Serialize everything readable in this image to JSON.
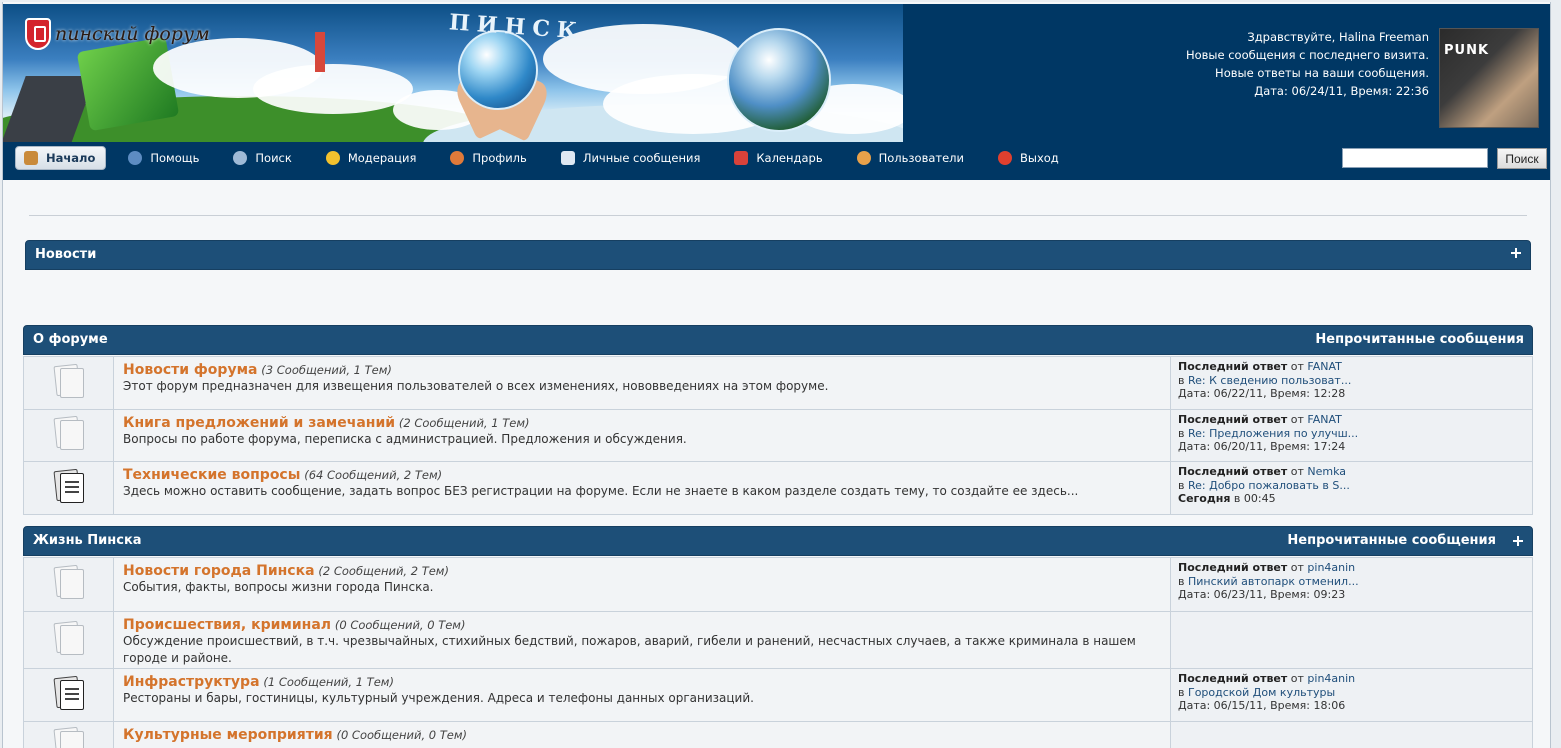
{
  "header": {
    "logo_text": "пинский форум",
    "banner_word": "ПИНСК",
    "user": {
      "greeting": "Здравствуйте, Halina Freeman",
      "new_since_visit": "Новые сообщения с последнего визита.",
      "new_replies": "Новые ответы на ваши сообщения.",
      "datetime": "Дата: 06/24/11, Время: 22:36"
    },
    "avatar_text": "PUNK"
  },
  "nav": {
    "items": [
      {
        "label": "Начало",
        "icon": "home-icon",
        "color": "#c98a3a"
      },
      {
        "label": "Помощь",
        "icon": "help-icon",
        "color": "#5d8cc2"
      },
      {
        "label": "Поиск",
        "icon": "search-icon",
        "color": "#9fbad6"
      },
      {
        "label": "Модерация",
        "icon": "star-icon",
        "color": "#f2c12e"
      },
      {
        "label": "Профиль",
        "icon": "profile-icon",
        "color": "#e07a3a"
      },
      {
        "label": "Личные сообщения",
        "icon": "mail-icon",
        "color": "#dfe8f2"
      },
      {
        "label": "Календарь",
        "icon": "calendar-icon",
        "color": "#d9423a"
      },
      {
        "label": "Пользователи",
        "icon": "users-icon",
        "color": "#e8a14a"
      },
      {
        "label": "Выход",
        "icon": "logout-icon",
        "color": "#e0402f"
      }
    ],
    "search_button": "Поиск",
    "search_value": ""
  },
  "news": {
    "title": "Новости"
  },
  "categories": [
    {
      "title": "О форуме",
      "unread": "Непрочитанные сообщения",
      "boards": [
        {
          "name": "Новости форума",
          "stats": "(3 Сообщений, 1 Тем)",
          "desc": "Этот форум предназначен для извещения пользователей о всех изменениях, нововведениях на этом форуме.",
          "icon": "board-read-icon",
          "last": {
            "label": "Последний ответ",
            "from": "от",
            "author": "FANAT",
            "in": "в",
            "topic": "Re: К сведению пользоват...",
            "date": "Дата: 06/22/11, Время: 12:28"
          }
        },
        {
          "name": "Книга предложений и замечаний",
          "stats": "(2 Сообщений, 1 Тем)",
          "desc": "Вопросы по работе форума, переписка с администрацией. Предложения и обсуждения.",
          "icon": "board-read-icon",
          "last": {
            "label": "Последний ответ",
            "from": "от",
            "author": "FANAT",
            "in": "в",
            "topic": "Re: Предложения по улучш...",
            "date": "Дата: 06/20/11, Время: 17:24"
          }
        },
        {
          "name": "Технические вопросы",
          "stats": "(64 Сообщений, 2 Тем)",
          "desc": "Здесь можно оставить сообщение, задать вопрос БЕЗ регистрации на форуме. Если не знаете в каком разделе создать тему, то создайте ее здесь...",
          "icon": "board-new-icon",
          "last": {
            "label": "Последний ответ",
            "from": "от",
            "author": "Nemka",
            "in": "в",
            "topic": "Re: Добро пожаловать в S...",
            "date_bold": "Сегодня",
            "date": "в 00:45"
          }
        }
      ]
    },
    {
      "title": "Жизнь Пинска",
      "unread": "Непрочитанные сообщения",
      "boards": [
        {
          "name": "Новости города Пинска",
          "stats": "(2 Сообщений, 2 Тем)",
          "desc": "События, факты, вопросы жизни города Пинска.",
          "icon": "board-read-icon",
          "last": {
            "label": "Последний ответ",
            "from": "от",
            "author": "pin4anin",
            "in": "в",
            "topic": "Пинский автопарк отменил...",
            "date": "Дата: 06/23/11, Время: 09:23"
          }
        },
        {
          "name": "Происшествия, криминал",
          "stats": "(0 Сообщений, 0 Тем)",
          "desc": "Обсуждение происшествий, в т.ч. чрезвычайных, стихийных бедствий, пожаров, аварий, гибели и ранений, несчастных случаев, а также криминала в нашем городе и районе.",
          "icon": "board-read-icon",
          "last": null
        },
        {
          "name": "Инфраструктура",
          "stats": "(1 Сообщений, 1 Тем)",
          "desc": "Рестораны и бары, гостиницы, культурный учреждения. Адреса и телефоны данных организаций.",
          "icon": "board-new-icon",
          "last": {
            "label": "Последний ответ",
            "from": "от",
            "author": "pin4anin",
            "in": "в",
            "topic": "Городской Дом культуры",
            "date": "Дата: 06/15/11, Время: 18:06"
          }
        },
        {
          "name": "Культурные мероприятия",
          "stats": "(0 Сообщений, 0 Тем)",
          "desc": "",
          "icon": "board-read-icon",
          "last": null
        }
      ]
    }
  ]
}
